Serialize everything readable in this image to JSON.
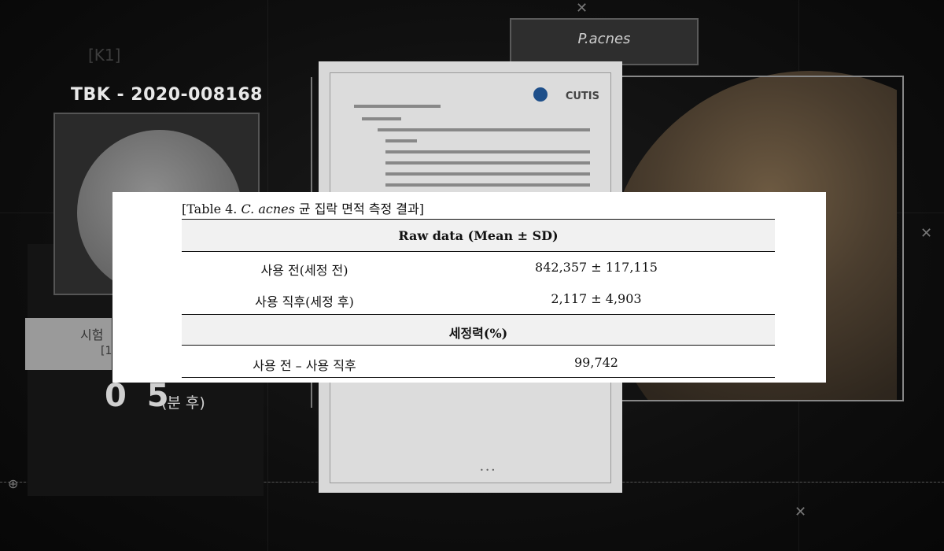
{
  "background": {
    "k1_label": "[K1]",
    "case_id": "TBK - 2020-008168",
    "time_digits": "0 5",
    "time_unit": "(분 후)",
    "side_label": "시험",
    "side_label_sub": "[1",
    "organism_label": "P.acnes",
    "doc_brand": "CUTIS",
    "doc_page_dots": "• • •"
  },
  "table": {
    "caption_prefix": "[Table 4. ",
    "caption_species": "C. acnes",
    "caption_suffix": " 균 집락 면적 측정 결과]",
    "section1_header": "Raw data (Mean ± SD)",
    "rows1": [
      {
        "label": "사용 전(세정 전)",
        "value": "842,357 ± 117,115"
      },
      {
        "label": "사용 직후(세정 후)",
        "value": "2,117 ± 4,903"
      }
    ],
    "section2_header": "세정력(%)",
    "rows2": [
      {
        "label": "사용 전 – 사용 직후",
        "value": "99,742"
      }
    ]
  }
}
